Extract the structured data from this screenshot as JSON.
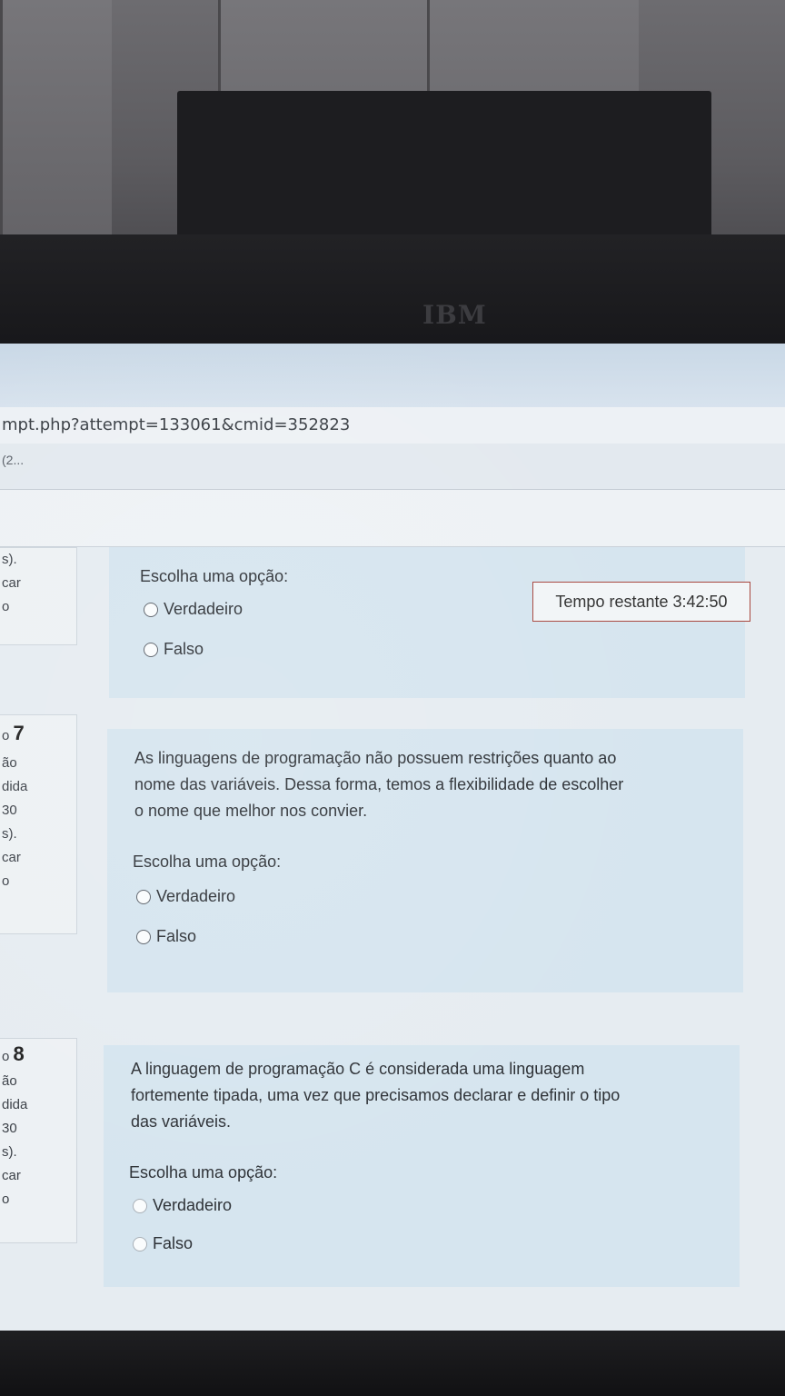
{
  "browser": {
    "url": "mpt.php?attempt=133061&cmid=352823",
    "tab_title": "(2..."
  },
  "monitor": {
    "brand_top": "IBM"
  },
  "timer": {
    "label": "Tempo restante",
    "value": "3:42:50"
  },
  "prev_question": {
    "info": [
      "s).",
      "car",
      "o"
    ],
    "prompt": "Escolha uma opção:",
    "options": [
      "Verdadeiro",
      "Falso"
    ]
  },
  "q7": {
    "number_prefix": "o",
    "number": "7",
    "info": [
      "ão",
      "dida",
      "30",
      "s).",
      "car",
      "o"
    ],
    "text_lines": [
      "As linguagens de programação não possuem restrições quanto ao",
      "nome das variáveis. Dessa forma, temos a flexibilidade de escolher",
      "o nome que melhor nos convier."
    ],
    "prompt": "Escolha uma opção:",
    "options": [
      "Verdadeiro",
      "Falso"
    ]
  },
  "q8": {
    "number_prefix": "o",
    "number": "8",
    "info": [
      "ão",
      "dida",
      "30",
      "s).",
      "car",
      "o"
    ],
    "text_lines": [
      "A linguagem de programação C é considerada uma linguagem",
      "fortemente tipada, uma vez que precisamos declarar e definir o tipo",
      "das variáveis."
    ],
    "prompt": "Escolha uma opção:",
    "options": [
      "Verdadeiro",
      "Falso"
    ]
  }
}
